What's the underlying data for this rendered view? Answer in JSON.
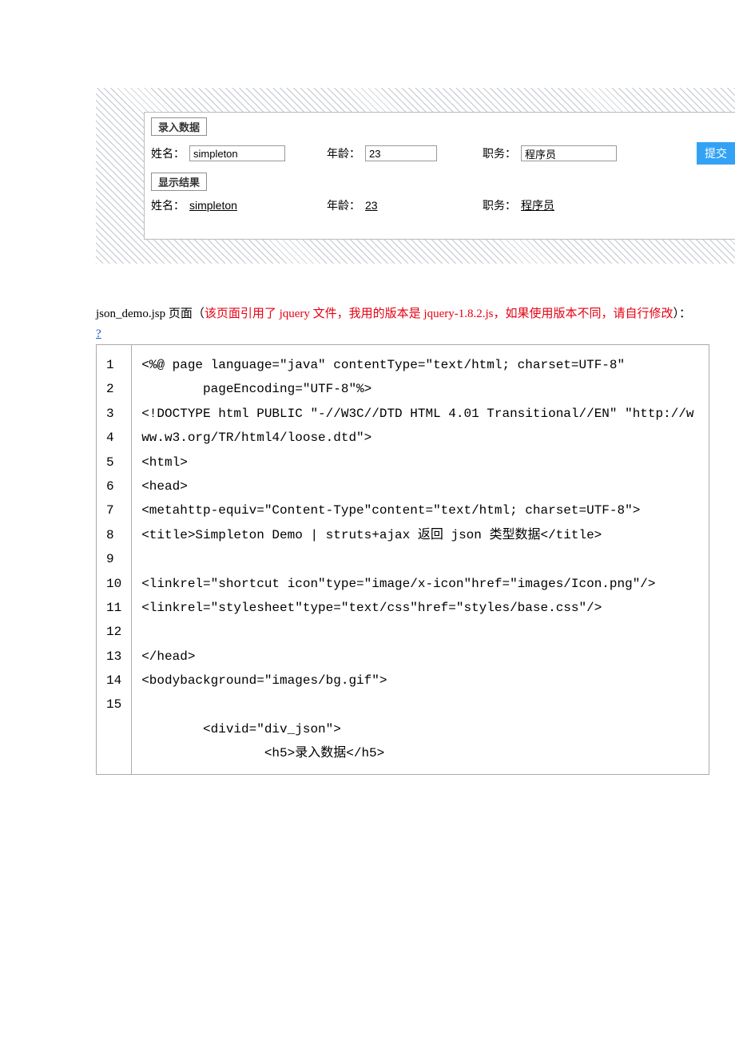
{
  "form_demo": {
    "fieldsets": {
      "input_legend": "录入数据",
      "result_legend": "显示结果"
    },
    "labels": {
      "name": "姓名：",
      "age": "年龄：",
      "job": "职务："
    },
    "inputs": {
      "name_value": "simpleton",
      "age_value": "23",
      "job_value": "程序员"
    },
    "results": {
      "name": "simpleton",
      "age": "23",
      "job": "程序员"
    },
    "submit_label": "提交"
  },
  "description": {
    "prefix": "json_demo.jsp 页面（",
    "red_part": "该页面引用了 jquery 文件，我用的版本是 jquery-1.8.2.js，如果使用版本不同，请自行修改",
    "suffix": "）："
  },
  "question_link": "?",
  "code": {
    "line_numbers": [
      "1",
      "2",
      "3",
      "4",
      "5",
      "6",
      "7",
      "8",
      "9",
      "10",
      "11",
      "12",
      "13",
      "14",
      "15"
    ],
    "content": "<%@ page language=\"java\" contentType=\"text/html; charset=UTF-8\"\n        pageEncoding=\"UTF-8\"%>\n<!DOCTYPE html PUBLIC \"-//W3C//DTD HTML 4.01 Transitional//EN\" \"http://www.w3.org/TR/html4/loose.dtd\">\n<html>\n<head>\n<metahttp-equiv=\"Content-Type\"content=\"text/html; charset=UTF-8\">\n<title>Simpleton Demo | struts+ajax 返回 json 类型数据</title>\n\n<linkrel=\"shortcut icon\"type=\"image/x-icon\"href=\"images/Icon.png\"/>\n<linkrel=\"stylesheet\"type=\"text/css\"href=\"styles/base.css\"/>\n\n</head>\n<bodybackground=\"images/bg.gif\">\n\n        <divid=\"div_json\">\n                <h5>录入数据</h5>"
  }
}
